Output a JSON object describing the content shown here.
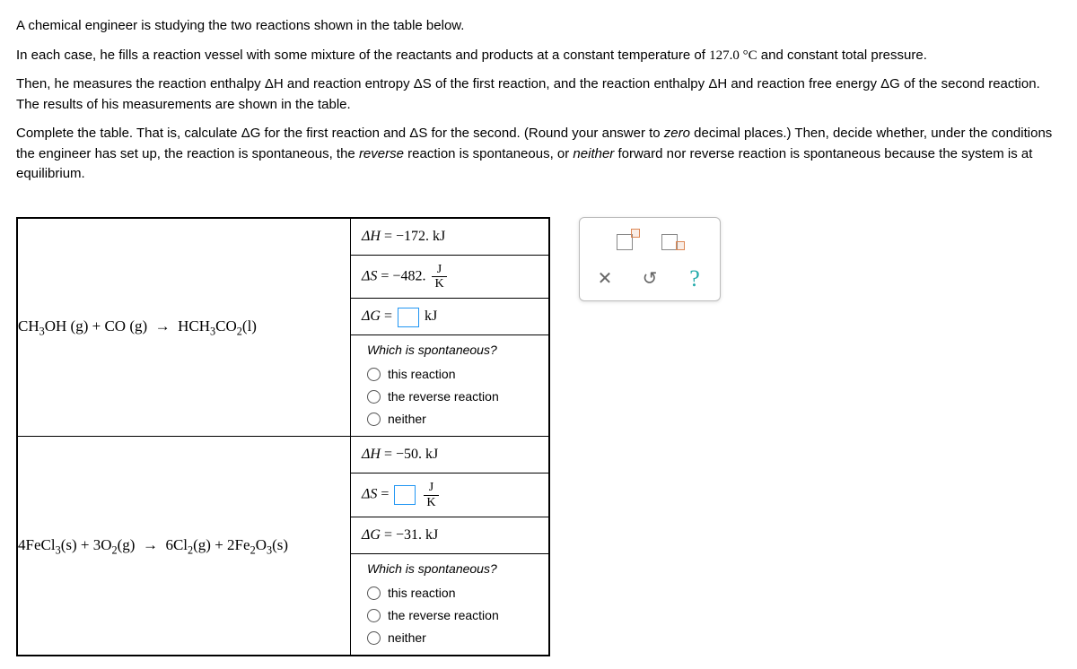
{
  "intro": {
    "p1": "A chemical engineer is studying the two reactions shown in the table below.",
    "p2_a": "In each case, he fills a reaction vessel with some mixture of the reactants and products at a constant temperature of ",
    "p2_temp": "127.0 °C",
    "p2_b": " and constant total pressure.",
    "p3": "Then, he measures the reaction enthalpy ΔH and reaction entropy ΔS of the first reaction, and the reaction enthalpy ΔH and reaction free energy ΔG of the second reaction. The results of his measurements are shown in the table.",
    "p4_a": "Complete the table. That is, calculate ΔG for the first reaction and ΔS for the second. (Round your answer to ",
    "p4_zero": "zero",
    "p4_b": " decimal places.) Then, decide whether, under the conditions the engineer has set up, the reaction is spontaneous, the ",
    "p4_rev": "reverse",
    "p4_c": " reaction is spontaneous, or ",
    "p4_neither": "neither",
    "p4_d": " forward nor reverse reaction is spontaneous because the system is at equilibrium."
  },
  "r1": {
    "dH_label": "ΔH",
    "dH_val": " = −172. kJ",
    "dS_label": "ΔS",
    "dS_val_prefix": " = −482. ",
    "frac_num": "J",
    "frac_den": "K",
    "dG_label": "ΔG",
    "dG_eq": " = ",
    "dG_unit": " kJ"
  },
  "r2": {
    "dH_label": "ΔH",
    "dH_val": " = −50. kJ",
    "dS_label": "ΔS",
    "dS_eq": " = ",
    "frac_num": "J",
    "frac_den": "K",
    "dG_label": "ΔG",
    "dG_val": " = −31. kJ"
  },
  "question": "Which is spontaneous?",
  "options": {
    "a": "this reaction",
    "b": "the reverse reaction",
    "c": "neither"
  },
  "toolbar": {
    "clear": "✕",
    "reset": "↺",
    "help": "?"
  }
}
